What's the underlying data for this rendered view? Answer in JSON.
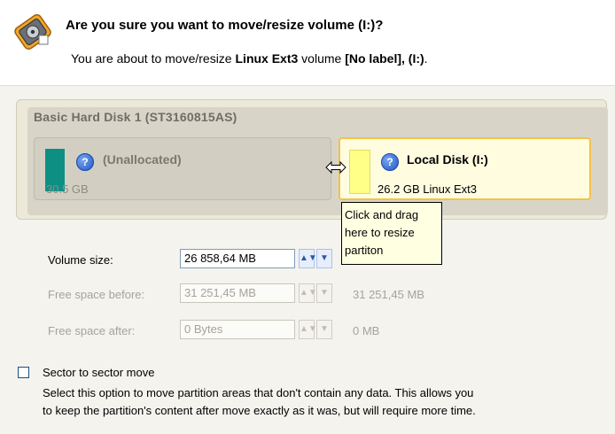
{
  "header": {
    "title": "Are you sure you want to move/resize volume (I:)?",
    "desc_prefix": "You are about to move/resize ",
    "desc_fs": "Linux Ext3",
    "desc_middle": " volume ",
    "desc_volume": "[No label], (I:)",
    "desc_suffix": "."
  },
  "disk": {
    "title": "Basic Hard Disk 1 (ST3160815AS)",
    "volumes": [
      {
        "name": "(Unallocated)",
        "size": "30.5 GB",
        "color": "#0d8f84"
      },
      {
        "name": "Local Disk (I:)",
        "size": "26.2 GB Linux Ext3",
        "color": "#ffff88"
      }
    ]
  },
  "tooltip": {
    "line1": "Click and drag",
    "line2": "here to resize",
    "line3": "partiton"
  },
  "form": {
    "volume_size": {
      "label": "Volume size:",
      "value": "26 858,64 MB"
    },
    "free_before": {
      "label": "Free space before:",
      "value": "31 251,45 MB",
      "after": "31 251,45 MB"
    },
    "free_after": {
      "label": "Free space after:",
      "value": "0 Bytes",
      "after": "0 MB"
    }
  },
  "sector_move": {
    "label": "Sector to sector move",
    "desc_line1": "Select this option to move partition areas that don't contain any data. This allows you",
    "desc_line2": "to keep the partition's content after move exactly as it was, but will require more time."
  },
  "icons": {
    "wizard": "hard-disk-wizard-icon",
    "help": "help-question-icon",
    "cursor": "resize-arrows-cursor-icon"
  },
  "colors": {
    "accent_border": "#f3c24a",
    "unallocated": "#0d8f84",
    "ext3": "#ffff88"
  }
}
